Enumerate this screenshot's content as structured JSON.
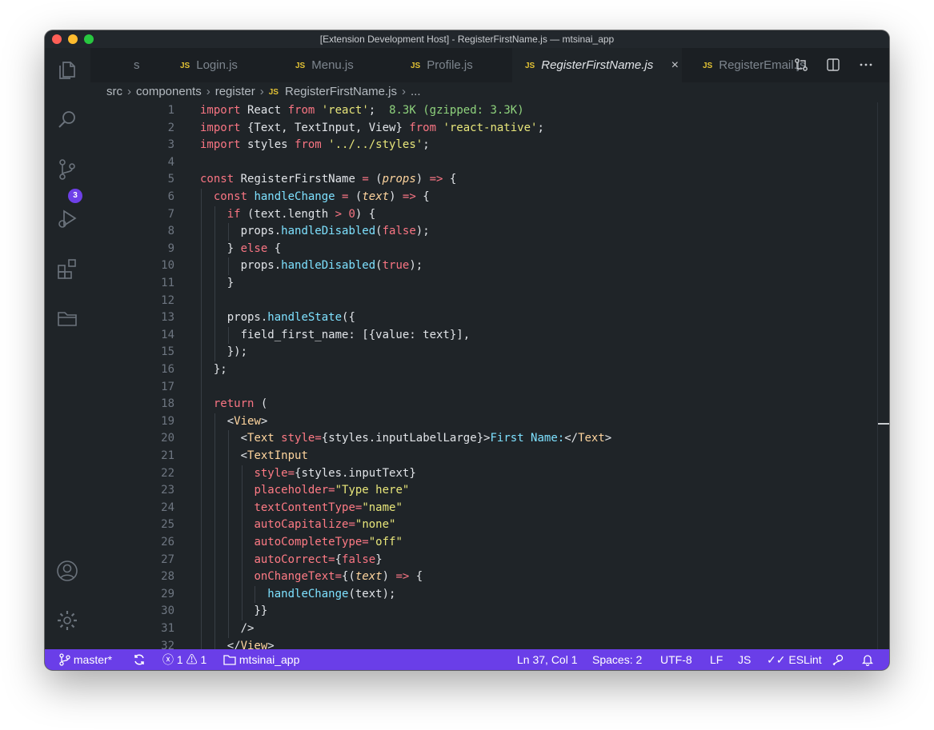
{
  "window": {
    "title": "[Extension Development Host] - RegisterFirstName.js — mtsinai_app"
  },
  "activity_bar": {
    "icons": [
      "explorer-icon",
      "search-icon",
      "source-control-icon",
      "run-debug-icon",
      "extensions-icon",
      "folder-icon",
      "account-icon",
      "settings-icon"
    ],
    "source_control_badge": "3"
  },
  "tabs": [
    {
      "label": "s",
      "partial": true
    },
    {
      "badge": "JS",
      "label": "Login.js"
    },
    {
      "badge": "JS",
      "label": "Menu.js"
    },
    {
      "badge": "JS",
      "label": "Profile.js"
    },
    {
      "badge": "JS",
      "label": "RegisterFirstName.js",
      "active": true
    },
    {
      "badge": "JS",
      "label": "RegisterEmail.js"
    }
  ],
  "tab_close_glyph": "×",
  "tab_actions": [
    "compare-changes-icon",
    "split-editor-icon",
    "more-actions-icon"
  ],
  "breadcrumb": {
    "segments": [
      "src",
      "components",
      "register"
    ],
    "file_badge": "JS",
    "file": "RegisterFirstName.js",
    "trailing": "..."
  },
  "editor": {
    "lines": [
      {
        "n": "1",
        "tokens": [
          [
            "kw",
            "import"
          ],
          [
            "plain",
            " React "
          ],
          [
            "kw",
            "from"
          ],
          [
            "plain",
            " "
          ],
          [
            "str",
            "'react'"
          ],
          [
            "plain",
            ";  "
          ],
          [
            "info",
            "8.3K (gzipped: 3.3K)"
          ]
        ]
      },
      {
        "n": "2",
        "tokens": [
          [
            "kw",
            "import"
          ],
          [
            "plain",
            " {Text, TextInput, View} "
          ],
          [
            "kw",
            "from"
          ],
          [
            "plain",
            " "
          ],
          [
            "str",
            "'react-native'"
          ],
          [
            "plain",
            ";"
          ]
        ]
      },
      {
        "n": "3",
        "tokens": [
          [
            "kw",
            "import"
          ],
          [
            "plain",
            " styles "
          ],
          [
            "kw",
            "from"
          ],
          [
            "plain",
            " "
          ],
          [
            "str",
            "'../../styles'"
          ],
          [
            "plain",
            ";"
          ]
        ]
      },
      {
        "n": "4",
        "tokens": []
      },
      {
        "n": "5",
        "tokens": [
          [
            "kw",
            "const"
          ],
          [
            "plain",
            " RegisterFirstName "
          ],
          [
            "kw",
            "="
          ],
          [
            "plain",
            " ("
          ],
          [
            "param",
            "props"
          ],
          [
            "plain",
            ") "
          ],
          [
            "kw",
            "=>"
          ],
          [
            "plain",
            " {"
          ]
        ]
      },
      {
        "n": "6",
        "tokens": [
          [
            "plain",
            "  "
          ],
          [
            "kw",
            "const"
          ],
          [
            "plain",
            " "
          ],
          [
            "fn",
            "handleChange"
          ],
          [
            "plain",
            " "
          ],
          [
            "kw",
            "="
          ],
          [
            "plain",
            " ("
          ],
          [
            "param",
            "text"
          ],
          [
            "plain",
            ") "
          ],
          [
            "kw",
            "=>"
          ],
          [
            "plain",
            " {"
          ]
        ]
      },
      {
        "n": "7",
        "tokens": [
          [
            "plain",
            "    "
          ],
          [
            "kw",
            "if"
          ],
          [
            "plain",
            " (text.length "
          ],
          [
            "kw",
            ">"
          ],
          [
            "plain",
            " "
          ],
          [
            "num",
            "0"
          ],
          [
            "plain",
            ") {"
          ]
        ]
      },
      {
        "n": "8",
        "tokens": [
          [
            "plain",
            "      props."
          ],
          [
            "fn",
            "handleDisabled"
          ],
          [
            "plain",
            "("
          ],
          [
            "kw",
            "false"
          ],
          [
            "plain",
            ");"
          ]
        ]
      },
      {
        "n": "9",
        "tokens": [
          [
            "plain",
            "    } "
          ],
          [
            "kw",
            "else"
          ],
          [
            "plain",
            " {"
          ]
        ]
      },
      {
        "n": "10",
        "tokens": [
          [
            "plain",
            "      props."
          ],
          [
            "fn",
            "handleDisabled"
          ],
          [
            "plain",
            "("
          ],
          [
            "kw",
            "true"
          ],
          [
            "plain",
            ");"
          ]
        ]
      },
      {
        "n": "11",
        "tokens": [
          [
            "plain",
            "    }"
          ]
        ]
      },
      {
        "n": "12",
        "tokens": []
      },
      {
        "n": "13",
        "tokens": [
          [
            "plain",
            "    props."
          ],
          [
            "fn",
            "handleState"
          ],
          [
            "plain",
            "({"
          ]
        ]
      },
      {
        "n": "14",
        "tokens": [
          [
            "plain",
            "      field_first_name: [{value: text}],"
          ]
        ]
      },
      {
        "n": "15",
        "tokens": [
          [
            "plain",
            "    });"
          ]
        ]
      },
      {
        "n": "16",
        "tokens": [
          [
            "plain",
            "  };"
          ]
        ]
      },
      {
        "n": "17",
        "tokens": []
      },
      {
        "n": "18",
        "tokens": [
          [
            "plain",
            "  "
          ],
          [
            "kw",
            "return"
          ],
          [
            "plain",
            " ("
          ]
        ]
      },
      {
        "n": "19",
        "tokens": [
          [
            "plain",
            "    <"
          ],
          [
            "tag",
            "View"
          ],
          [
            "plain",
            ">"
          ]
        ]
      },
      {
        "n": "20",
        "tokens": [
          [
            "plain",
            "      <"
          ],
          [
            "tag",
            "Text"
          ],
          [
            "plain",
            " "
          ],
          [
            "attr",
            "style"
          ],
          [
            "kw",
            "="
          ],
          [
            "plain",
            "{styles.inputLabelLarge}>"
          ],
          [
            "fn",
            "First Name:"
          ],
          [
            "plain",
            "</"
          ],
          [
            "tag",
            "Text"
          ],
          [
            "plain",
            ">"
          ]
        ]
      },
      {
        "n": "21",
        "tokens": [
          [
            "plain",
            "      <"
          ],
          [
            "tag",
            "TextInput"
          ]
        ]
      },
      {
        "n": "22",
        "tokens": [
          [
            "plain",
            "        "
          ],
          [
            "attr",
            "style"
          ],
          [
            "kw",
            "="
          ],
          [
            "plain",
            "{styles.inputText}"
          ]
        ]
      },
      {
        "n": "23",
        "tokens": [
          [
            "plain",
            "        "
          ],
          [
            "attr",
            "placeholder"
          ],
          [
            "kw",
            "="
          ],
          [
            "str",
            "\"Type here\""
          ]
        ]
      },
      {
        "n": "24",
        "tokens": [
          [
            "plain",
            "        "
          ],
          [
            "attr",
            "textContentType"
          ],
          [
            "kw",
            "="
          ],
          [
            "str",
            "\"name\""
          ]
        ]
      },
      {
        "n": "25",
        "tokens": [
          [
            "plain",
            "        "
          ],
          [
            "attr",
            "autoCapitalize"
          ],
          [
            "kw",
            "="
          ],
          [
            "str",
            "\"none\""
          ]
        ]
      },
      {
        "n": "26",
        "tokens": [
          [
            "plain",
            "        "
          ],
          [
            "attr",
            "autoCompleteType"
          ],
          [
            "kw",
            "="
          ],
          [
            "str",
            "\"off\""
          ]
        ]
      },
      {
        "n": "27",
        "tokens": [
          [
            "plain",
            "        "
          ],
          [
            "attr",
            "autoCorrect"
          ],
          [
            "kw",
            "="
          ],
          [
            "plain",
            "{"
          ],
          [
            "kw",
            "false"
          ],
          [
            "plain",
            "}"
          ]
        ]
      },
      {
        "n": "28",
        "tokens": [
          [
            "plain",
            "        "
          ],
          [
            "attr",
            "onChangeText"
          ],
          [
            "kw",
            "="
          ],
          [
            "plain",
            "{("
          ],
          [
            "param",
            "text"
          ],
          [
            "plain",
            ") "
          ],
          [
            "kw",
            "=>"
          ],
          [
            "plain",
            " {"
          ]
        ]
      },
      {
        "n": "29",
        "tokens": [
          [
            "plain",
            "          "
          ],
          [
            "fn",
            "handleChange"
          ],
          [
            "plain",
            "(text);"
          ]
        ]
      },
      {
        "n": "30",
        "tokens": [
          [
            "plain",
            "        }}"
          ]
        ]
      },
      {
        "n": "31",
        "tokens": [
          [
            "plain",
            "      />"
          ]
        ]
      },
      {
        "n": "32",
        "tokens": [
          [
            "plain",
            "    </"
          ],
          [
            "tag",
            "View"
          ],
          [
            "plain",
            ">"
          ]
        ]
      }
    ]
  },
  "status_bar": {
    "branch": "master*",
    "errors": "1",
    "warnings": "1",
    "folder": "mtsinai_app",
    "position": "Ln 37, Col 1",
    "spaces": "Spaces: 2",
    "encoding": "UTF-8",
    "eol": "LF",
    "language": "JS",
    "linter": "ESLint"
  },
  "colors": {
    "status_bar": "#6a3ee8",
    "editor_bg": "#1f2428",
    "keyword": "#f97583",
    "string": "#e8e67a",
    "function": "#7ee1ff",
    "js_badge": "#e3c234"
  }
}
